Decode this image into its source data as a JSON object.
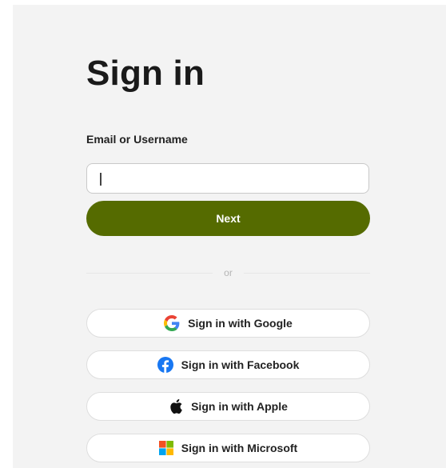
{
  "title": "Sign in",
  "email": {
    "label": "Email or Username",
    "value": "",
    "placeholder": ""
  },
  "next_label": "Next",
  "divider_text": "or",
  "social": {
    "google": {
      "label": "Sign in with Google",
      "icon": "google-icon"
    },
    "facebook": {
      "label": "Sign in with Facebook",
      "icon": "facebook-icon"
    },
    "apple": {
      "label": "Sign in with Apple",
      "icon": "apple-icon"
    },
    "microsoft": {
      "label": "Sign in with Microsoft",
      "icon": "microsoft-icon"
    }
  },
  "colors": {
    "primary_button": "#556b00",
    "panel_background": "#f3f3f3",
    "facebook_blue": "#1877f2"
  }
}
